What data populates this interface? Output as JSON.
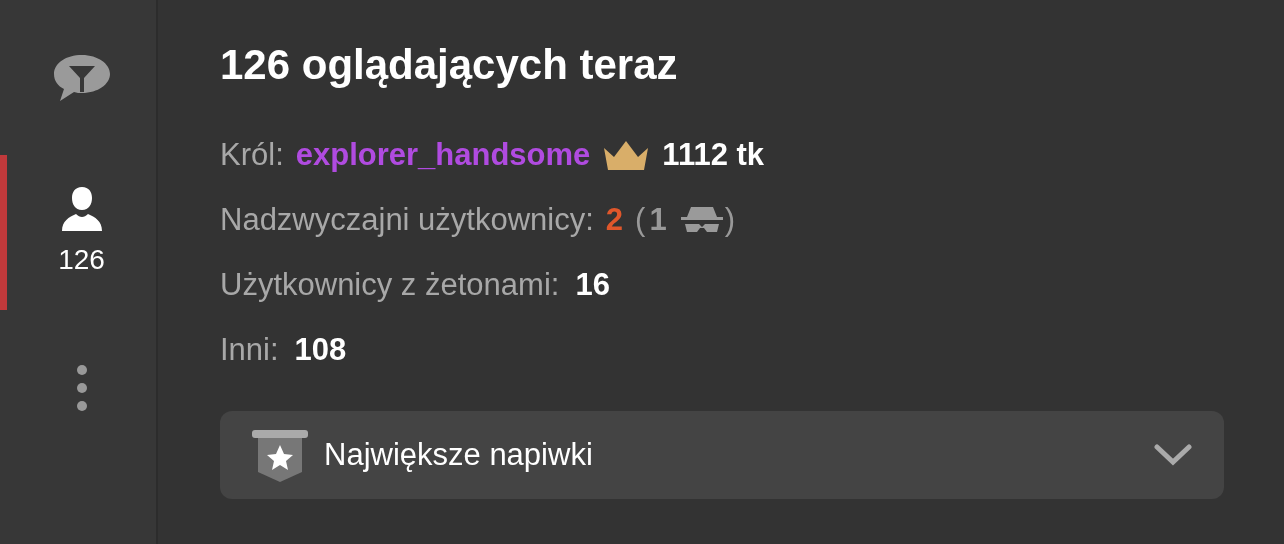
{
  "sidebar": {
    "tabs": [
      {
        "kind": "chat",
        "selected": false
      },
      {
        "kind": "users",
        "selected": true,
        "count": "126"
      },
      {
        "kind": "more",
        "selected": false
      }
    ]
  },
  "title": "126 oglądających teraz",
  "stats": [
    {
      "kind": "king",
      "label": "Król:",
      "username": "explorer_handsome",
      "value": "1112 tk"
    },
    {
      "kind": "special",
      "label": "Nadzwyczajni użytkownicy:",
      "value": "2",
      "open": "(",
      "hidden": "1",
      "close": ")"
    },
    {
      "kind": "plain",
      "label": "Użytkownicy z żetonami:",
      "value": "16"
    },
    {
      "kind": "plain",
      "label": "Inni:",
      "value": "108"
    }
  ],
  "dropdown": {
    "label": "Największe napiwki",
    "expanded": false
  }
}
